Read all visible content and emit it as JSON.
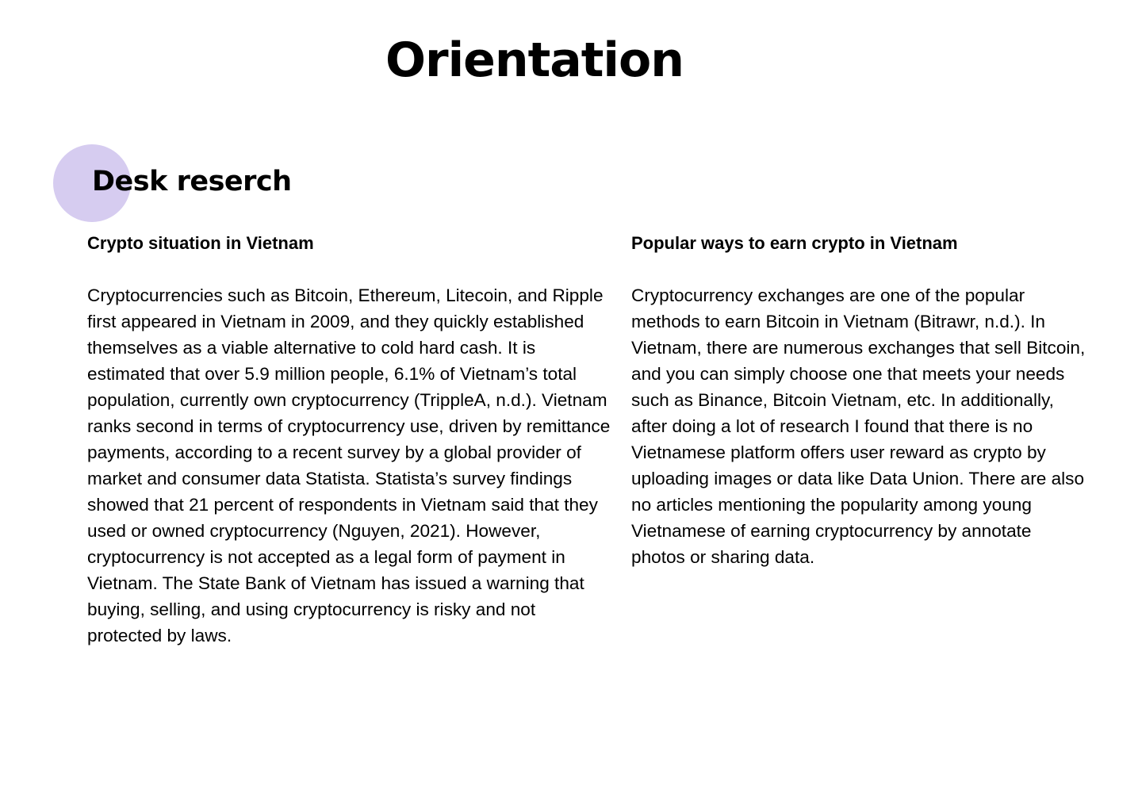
{
  "page": {
    "title": "Orientation"
  },
  "section": {
    "title": "Desk reserch",
    "accent_color": "#d6ccf0"
  },
  "columns": {
    "left": {
      "heading": "Crypto situation in Vietnam",
      "body": "Cryptocurrencies such as Bitcoin, Ethereum, Litecoin, and Ripple first appeared in Vietnam in 2009, and they quickly established themselves as a viable alternative to cold hard cash. It is estimated that over 5.9 million people, 6.1% of Vietnam’s total population, currently own cryptocurrency (TrippleA, n.d.). Vietnam ranks second in terms of cryptocurrency use, driven by remittance payments, according to a recent survey by a global provider of market and consumer data Statista. Statista’s survey findings showed that 21 percent of respondents in Vietnam said that they used or owned cryptocurrency (Nguyen, 2021). However, cryptocurrency is not accepted as a legal form of payment in Vietnam. The State Bank of Vietnam has issued a warning that buying, selling, and using cryptocurrency is risky and not protected by laws."
    },
    "right": {
      "heading": "Popular ways to earn crypto in Vietnam",
      "body": "Cryptocurrency exchanges are one of the popular methods to earn Bitcoin in Vietnam (Bitrawr, n.d.). In Vietnam, there are numerous exchanges that sell Bitcoin, and you can simply choose one that meets your needs such as Binance, Bitcoin Vietnam, etc. In additionally, after doing a lot of research I found that there is no Vietnamese platform offers user reward as crypto by uploading images or data like Data Union. There are also no articles mentioning the popularity among young Vietnamese of earning cryptocurrency by annotate photos or sharing data."
    }
  }
}
